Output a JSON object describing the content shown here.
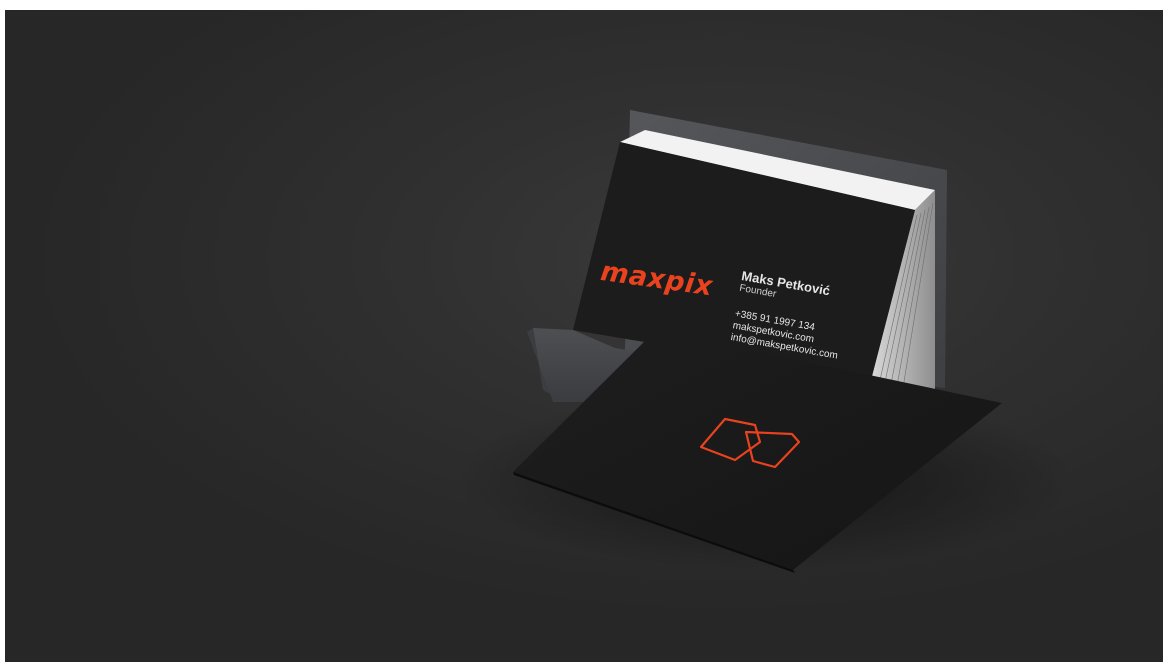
{
  "card_back": {
    "brand": "maxpix",
    "name": "Maks Petković",
    "role": "Founder",
    "phone": "+385 91 1997 134",
    "website": "makspetkovic.com",
    "email": "info@makspetkovic.com"
  },
  "colors": {
    "background": "#2e2e2e",
    "card": "#1b1b1b",
    "holder": "#4a4c50",
    "accent": "#e8421f"
  },
  "icons": {
    "card_front_logo": "maxpix-logo-icon"
  }
}
